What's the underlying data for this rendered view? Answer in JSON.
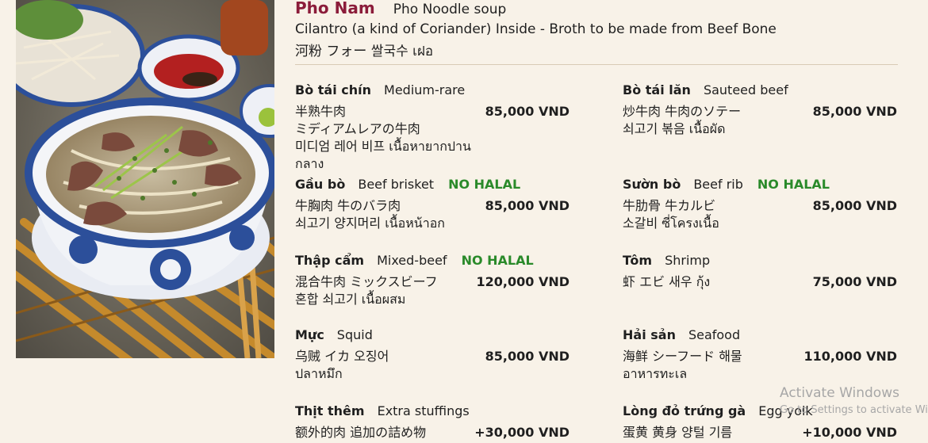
{
  "header": {
    "title": "Pho Nam",
    "subtitle": "Pho Noodle soup",
    "description": "Cilantro (a kind of Coriander) Inside - Broth to be made from Beef Bone",
    "translations": "河粉 フォー 쌀국수 เฝอ"
  },
  "items": [
    {
      "vn": "Bò tái chín",
      "en": "Medium-rare",
      "halal": "",
      "translations": [
        "半熟牛肉",
        "ミディアムレアの牛肉",
        "미디엄 레어 비프 เนื้อหายากปานกลาง"
      ],
      "price": "85,000 VND"
    },
    {
      "vn": "Bò tái lăn",
      "en": "Sauteed beef",
      "halal": "",
      "translations": [
        "炒牛肉 牛肉のソテー",
        "쇠고기 볶음 เนื้อผัด"
      ],
      "price": "85,000 VND"
    },
    {
      "vn": "Gầu bò",
      "en": "Beef brisket",
      "halal": "NO HALAL",
      "translations": [
        "牛胸肉 牛のバラ肉",
        "쇠고기 양지머리 เนื้อหน้าอก"
      ],
      "price": "85,000 VND"
    },
    {
      "vn": "Sườn bò",
      "en": "Beef rib",
      "halal": "NO HALAL",
      "translations": [
        "牛肋骨 牛カルビ",
        "소갈비 ซี่โครงเนื้อ"
      ],
      "price": "85,000 VND"
    },
    {
      "vn": "Thập cẩm",
      "en": "Mixed-beef",
      "halal": "NO HALAL",
      "translations": [
        "混合牛肉 ミックスビーフ",
        "혼합 쇠고기 เนื้อผสม"
      ],
      "price": "120,000 VND"
    },
    {
      "vn": "Tôm",
      "en": "Shrimp",
      "halal": "",
      "translations": [
        "虾 エビ 새우 กุ้ง"
      ],
      "price": "75,000 VND"
    },
    {
      "vn": "Mực",
      "en": "Squid",
      "halal": "",
      "translations": [
        "乌贼 イカ 오징어",
        "ปลาหมึก"
      ],
      "price": "85,000 VND"
    },
    {
      "vn": "Hải sản",
      "en": "Seafood",
      "halal": "",
      "translations": [
        "海鲜 シーフード 해물",
        "อาหารทะเล"
      ],
      "price": "110,000 VND"
    },
    {
      "vn": "Thịt thêm",
      "en": "Extra stuffings",
      "halal": "",
      "translations": [
        "额外的肉 追加の詰め物"
      ],
      "price": "+30,000 VND"
    },
    {
      "vn": "Lòng đỏ trứng gà",
      "en": "Egg yolk",
      "halal": "",
      "translations": [
        "蛋黄 黄身 양털 기름"
      ],
      "price": "+10,000 VND"
    }
  ],
  "watermark": {
    "title": "Activate Windows",
    "link": "Go to Settings to activate Windows."
  }
}
